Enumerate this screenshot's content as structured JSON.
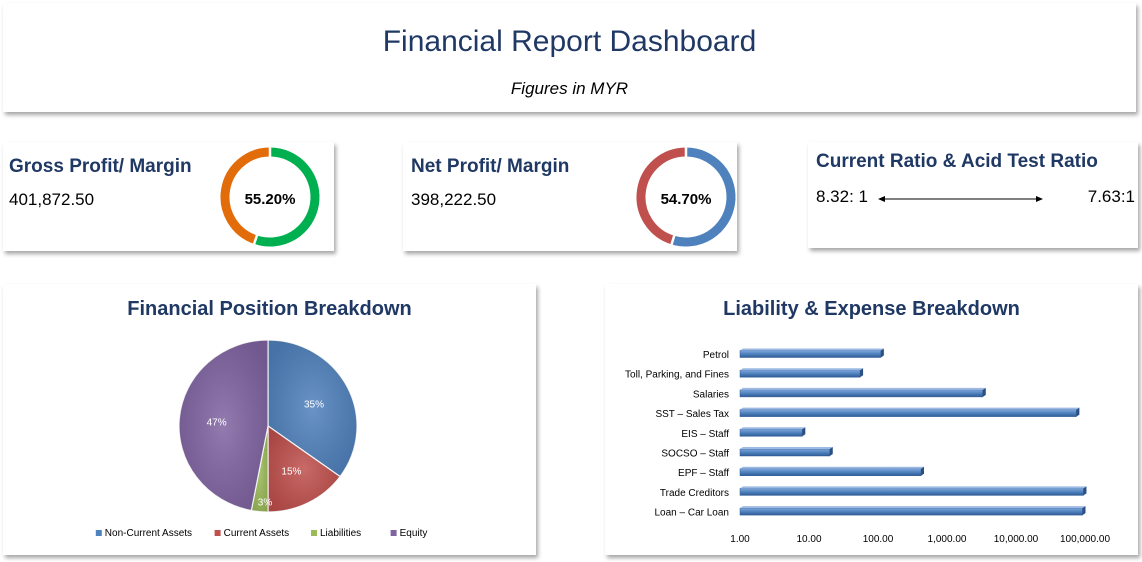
{
  "header": {
    "title": "Financial Report Dashboard",
    "subtitle": "Figures in MYR"
  },
  "kpis": {
    "gross": {
      "title": "Gross Profit/ Margin",
      "value": "401,872.50",
      "pct_label": "55.20%",
      "pct": 0.552,
      "color_main": "#00b050",
      "color_rest": "#e36c0a"
    },
    "net": {
      "title": "Net Profit/ Margin",
      "value": "398,222.50",
      "pct_label": "54.70%",
      "pct": 0.547,
      "color_main": "#4f81bd",
      "color_rest": "#c0504d"
    },
    "ratio": {
      "title": "Current Ratio & Acid Test Ratio",
      "current": "8.32: 1",
      "acid": "7.63:1"
    }
  },
  "chart_data": [
    {
      "type": "pie",
      "title": "Financial Position Breakdown",
      "slices": [
        {
          "name": "Non-Current Assets",
          "value": 35,
          "label": "35%",
          "color": "#4f81bd"
        },
        {
          "name": "Current Assets",
          "value": 15,
          "label": "15%",
          "color": "#c0504d"
        },
        {
          "name": "Liabilities",
          "value": 3,
          "label": "3%",
          "color": "#9bbb59"
        },
        {
          "name": "Equity",
          "value": 47,
          "label": "47%",
          "color": "#8064a2"
        }
      ],
      "legend": "bottom"
    },
    {
      "type": "bar",
      "orientation": "horizontal",
      "title": "Liability & Expense Breakdown",
      "categories": [
        "Petrol",
        "Toll, Parking, and Fines",
        "Salaries",
        "SST – Sales Tax",
        "EIS – Staff",
        "SOCSO – Staff",
        "EPF – Staff",
        "Trade Creditors",
        "Loan – Car Loan"
      ],
      "values": [
        110,
        55,
        3300,
        75000,
        8,
        20,
        420,
        95000,
        92000
      ],
      "xscale": "log",
      "xlim": [
        1,
        100000
      ],
      "xticks": [
        1,
        10,
        100,
        1000,
        10000,
        100000
      ],
      "xtick_labels": [
        "1.00",
        "10.00",
        "100.00",
        "1,000.00",
        "10,000.00",
        "100,000.00"
      ],
      "color": "#4f81bd"
    }
  ]
}
